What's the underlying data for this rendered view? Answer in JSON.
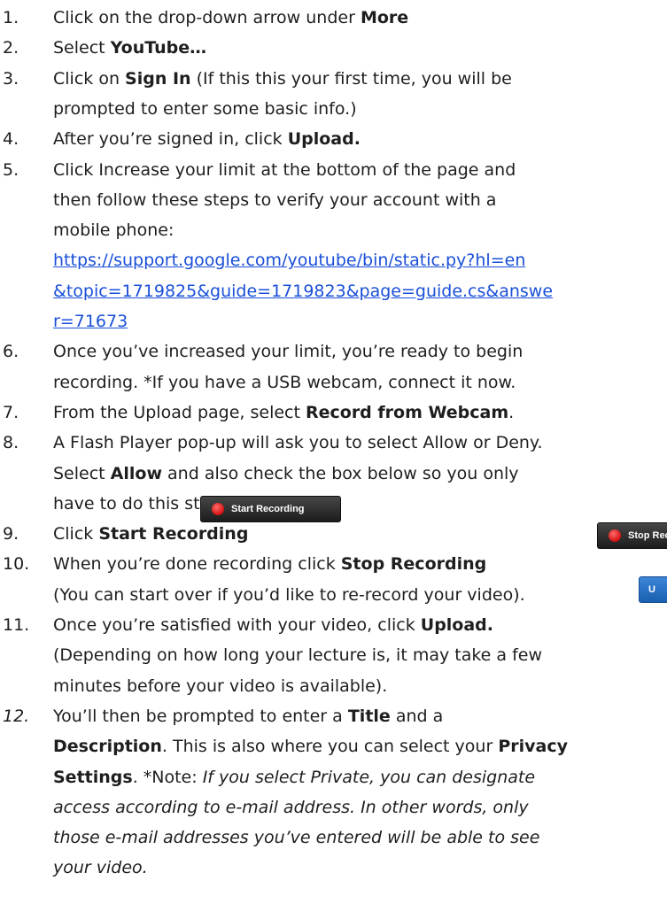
{
  "steps": [
    {
      "num": "1.",
      "lines": [
        [
          "Click on the drop-down arrow under ",
          {
            "b": "More"
          }
        ]
      ]
    },
    {
      "num": "2.",
      "lines": [
        [
          "Select ",
          {
            "b": "YouTube…"
          }
        ]
      ]
    },
    {
      "num": "3.",
      "lines": [
        [
          "Click on ",
          {
            "b": "Sign In"
          },
          " (If this this your first time, you will be"
        ],
        [
          "prompted to enter some basic info.)"
        ]
      ]
    },
    {
      "num": "4.",
      "lines": [
        [
          "After you’re signed in, click ",
          {
            "b": "Upload."
          }
        ]
      ]
    },
    {
      "num": "5.",
      "lines": [
        [
          "Click Increase your limit at the bottom of the page and"
        ],
        [
          "then follow these steps to verify your account with a"
        ],
        [
          "mobile phone:"
        ],
        [
          {
            "a": "https://support.google.com/youtube/bin/static.py?hl=en"
          }
        ],
        [
          {
            "a": "&topic=1719825&guide=1719823&page=guide.cs&answe"
          }
        ],
        [
          {
            "a": "r=71673"
          }
        ]
      ]
    },
    {
      "num": "6.",
      "lines": [
        [
          "Once you’ve increased your limit, you’re ready to begin"
        ],
        [
          "recording. *If you have a USB webcam, connect it now."
        ]
      ]
    },
    {
      "num": "7.",
      "lines": [
        [
          "From the Upload page, select ",
          {
            "b": "Record from Webcam"
          },
          "."
        ]
      ]
    },
    {
      "num": "8.",
      "lines": [
        [
          "A Flash Player pop-up will ask you to select Allow or Deny."
        ],
        [
          "Select ",
          {
            "b": "Allow"
          },
          " and also check the box below so you only"
        ],
        [
          "have to do this step once."
        ]
      ]
    },
    {
      "num": "9.",
      "lines": [
        [
          "Click ",
          {
            "b": "Start Recording"
          }
        ]
      ]
    },
    {
      "num": "10.",
      "lines": [
        [
          "When you’re done recording click ",
          {
            "b": "Stop Recording"
          }
        ],
        [
          "(You can start over if you’d like to re-record your video)."
        ]
      ]
    },
    {
      "num": "11.",
      "lines": [
        [
          "Once you’re satisfied with your video, click ",
          {
            "b": "Upload."
          }
        ],
        [
          "(Depending on how long your lecture is, it may take a few"
        ],
        [
          "minutes before your video is available)."
        ]
      ]
    },
    {
      "num": "12.",
      "num_italic": true,
      "lines": [
        [
          "You’ll then be prompted to enter a ",
          {
            "b": "Title"
          },
          " and a"
        ],
        [
          {
            "b": "Description"
          },
          ". This is also where you can select your ",
          {
            "b": "Privacy"
          }
        ],
        [
          {
            "b": "Settings"
          },
          ". *Note: ",
          {
            "i": "If you select Private, you can designate"
          }
        ],
        [
          {
            "i": "access according to e-mail address. In other words, only"
          }
        ],
        [
          {
            "i": "those e-mail addresses you’ve entered will be able to see"
          }
        ],
        [
          {
            "i": "your video."
          }
        ]
      ]
    }
  ],
  "buttons": {
    "start_recording": "Start Recording",
    "stop_recording": "Stop Rec",
    "upload": "U"
  }
}
